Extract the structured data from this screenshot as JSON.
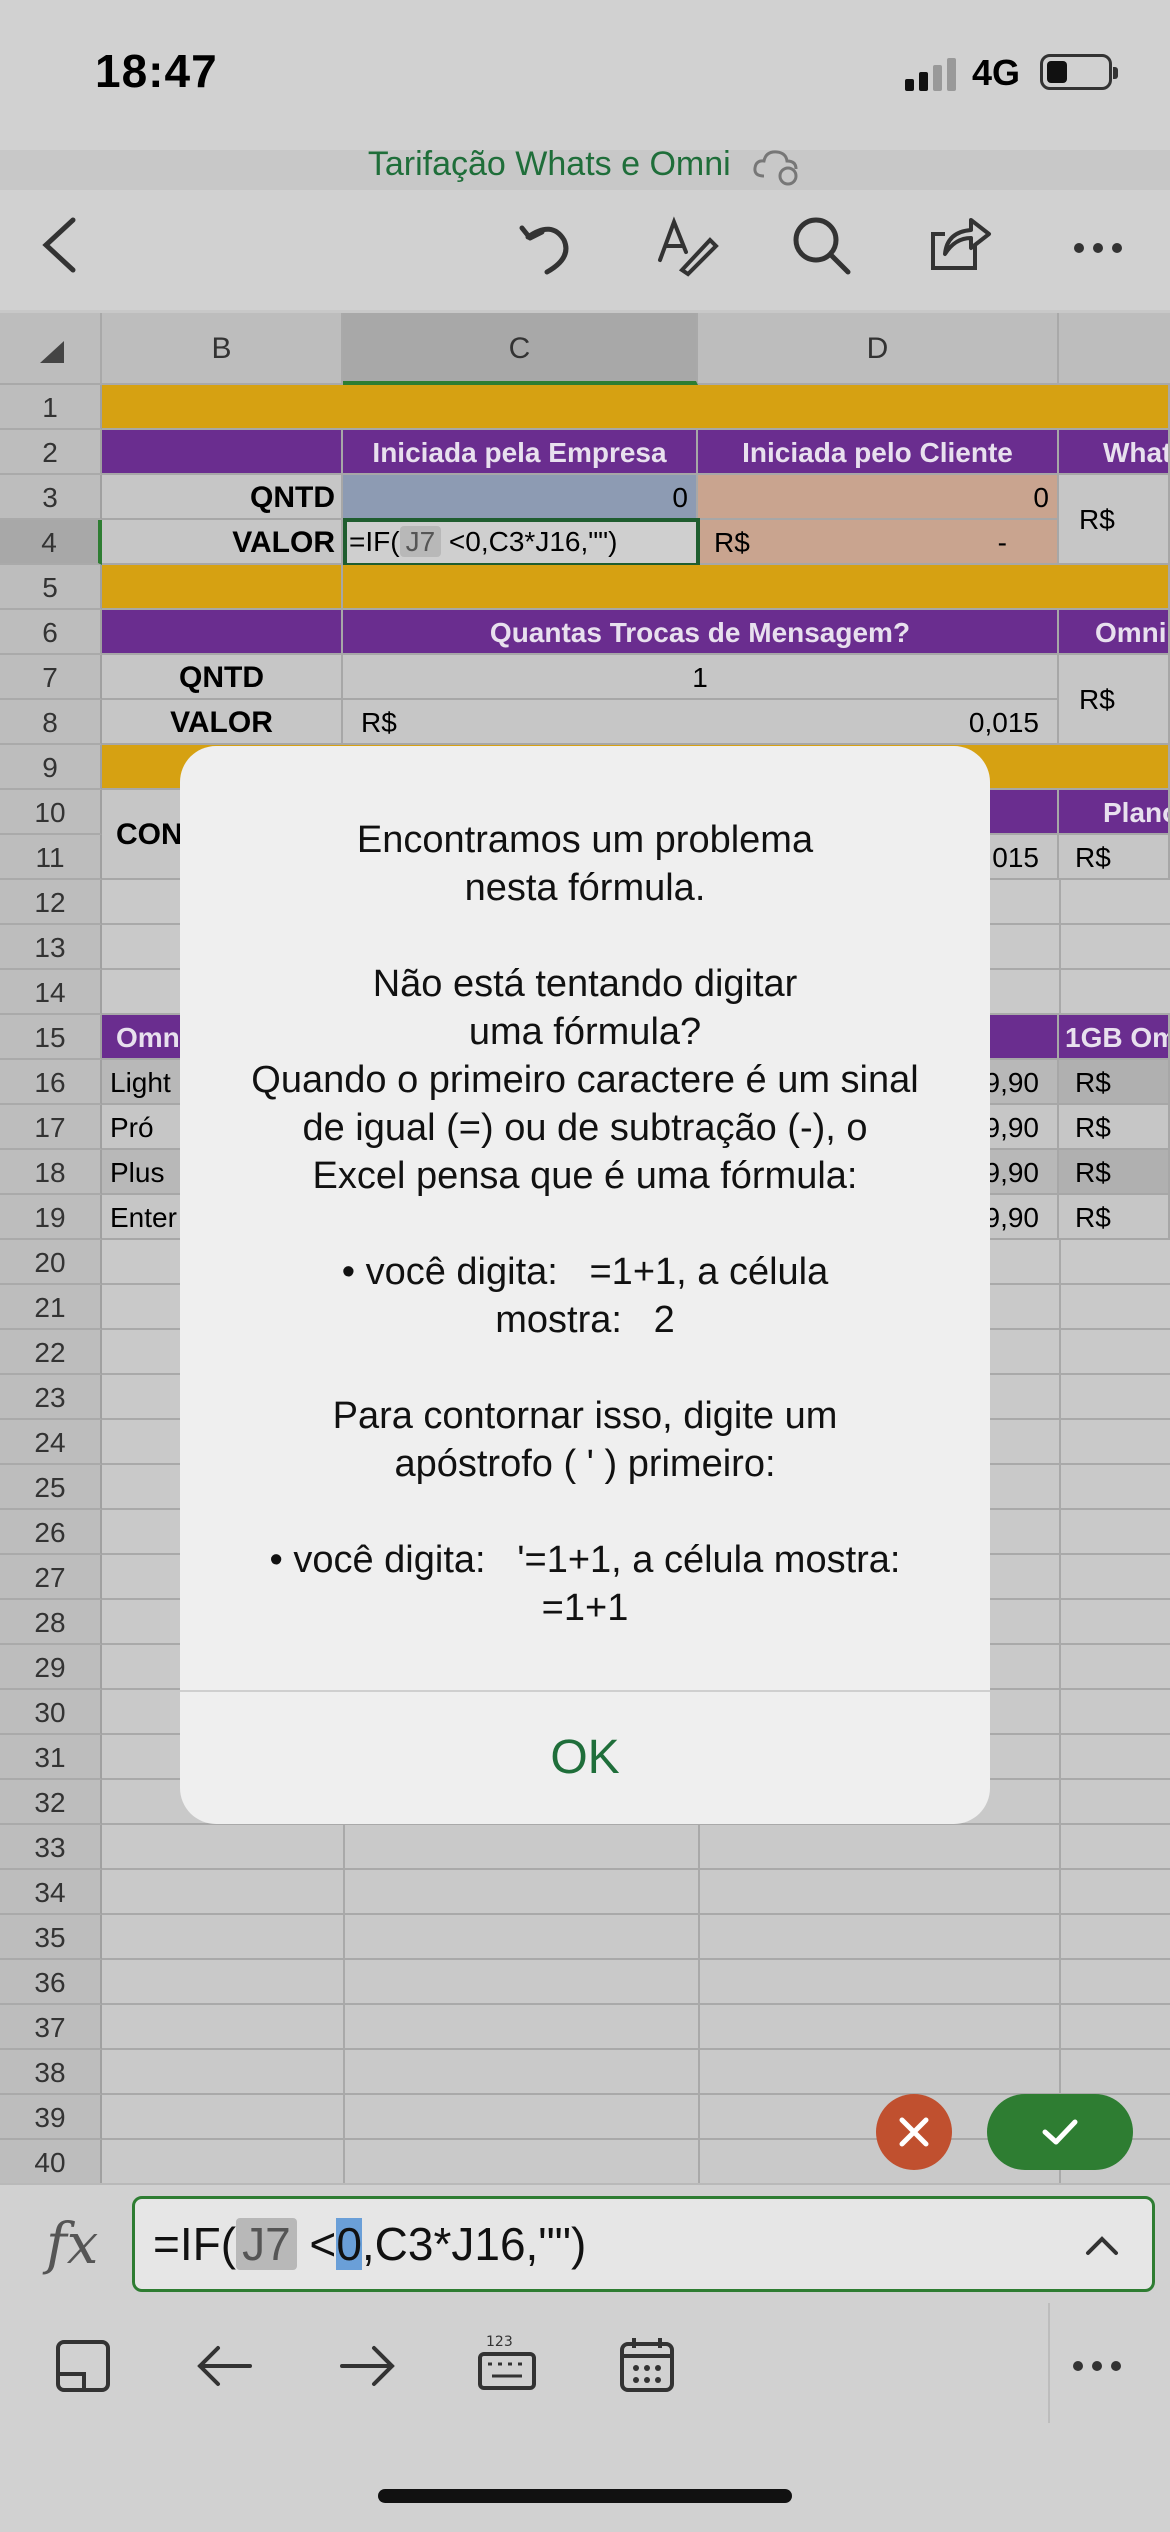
{
  "status_bar": {
    "time": "18:47",
    "network": "4G"
  },
  "document": {
    "title": "Tarifação Whats e Omni"
  },
  "grid": {
    "columns": [
      "B",
      "C",
      "D"
    ],
    "rows": [
      "1",
      "2",
      "3",
      "4",
      "5",
      "6",
      "7",
      "8",
      "9",
      "10",
      "11",
      "12",
      "13",
      "14",
      "15",
      "16",
      "17",
      "18",
      "19",
      "20",
      "21",
      "22",
      "23",
      "24",
      "25",
      "26",
      "27",
      "28",
      "29",
      "30",
      "31",
      "32",
      "33",
      "34",
      "35",
      "36",
      "37",
      "38",
      "39",
      "40"
    ],
    "cells": {
      "c2": "Iniciada pela Empresa",
      "d2": "Iniciada pelo Cliente",
      "e2": "Whats",
      "b3": "QNTD",
      "c3": "0",
      "d3": "0",
      "e3": "R$",
      "b4": "VALOR",
      "c4_prefix": "=IF(",
      "c4_ref": "J7",
      "c4_suffix": " <0,C3*J16,\"\")",
      "d4_currency": "R$",
      "d4_value": "-",
      "c6": "Quantas Trocas de Mensagem?",
      "e6": "Omni",
      "b7": "QNTD",
      "c7": "1",
      "e7": "R$",
      "b8": "VALOR",
      "c8_currency": "R$",
      "c8_value": "0,015",
      "e10": "Plano",
      "b10": "CON",
      "d11": "015",
      "e11": "R$",
      "b15": "Omn",
      "e15": "1GB Om",
      "b16": "Light",
      "b17": "Pró",
      "b18": "Plus",
      "b19": "Enter",
      "d16": "9,90",
      "d17": "9,90",
      "d18": "9,90",
      "d19": "9,90",
      "e16": "R$",
      "e17": "R$",
      "e18": "R$",
      "e19": "R$"
    }
  },
  "dialog": {
    "message": "Encontramos um problema\nnesta fórmula.\n\nNão está tentando digitar\numa fórmula?\nQuando o primeiro caractere é um sinal\nde igual (=) ou de subtração (-), o\nExcel pensa que é uma fórmula:\n\n• você digita:   =1+1, a célula\nmostra:   2\n\nPara contornar isso, digite um\napóstrofo ( ' ) primeiro:\n\n• você digita:   '=1+1, a célula mostra:\n=1+1",
    "ok_label": "OK"
  },
  "formula_bar": {
    "fx_label": "fx",
    "prefix": "=IF(",
    "ref": "J7",
    "mid": " <",
    "selected": "0",
    "suffix": ",C3*J16,\"\")"
  },
  "colors": {
    "accent": "#1f6e3a",
    "purple": "#6a2d8f",
    "gold": "#d6a112",
    "cancel": "#c0502f",
    "confirm": "#2e7d32"
  }
}
